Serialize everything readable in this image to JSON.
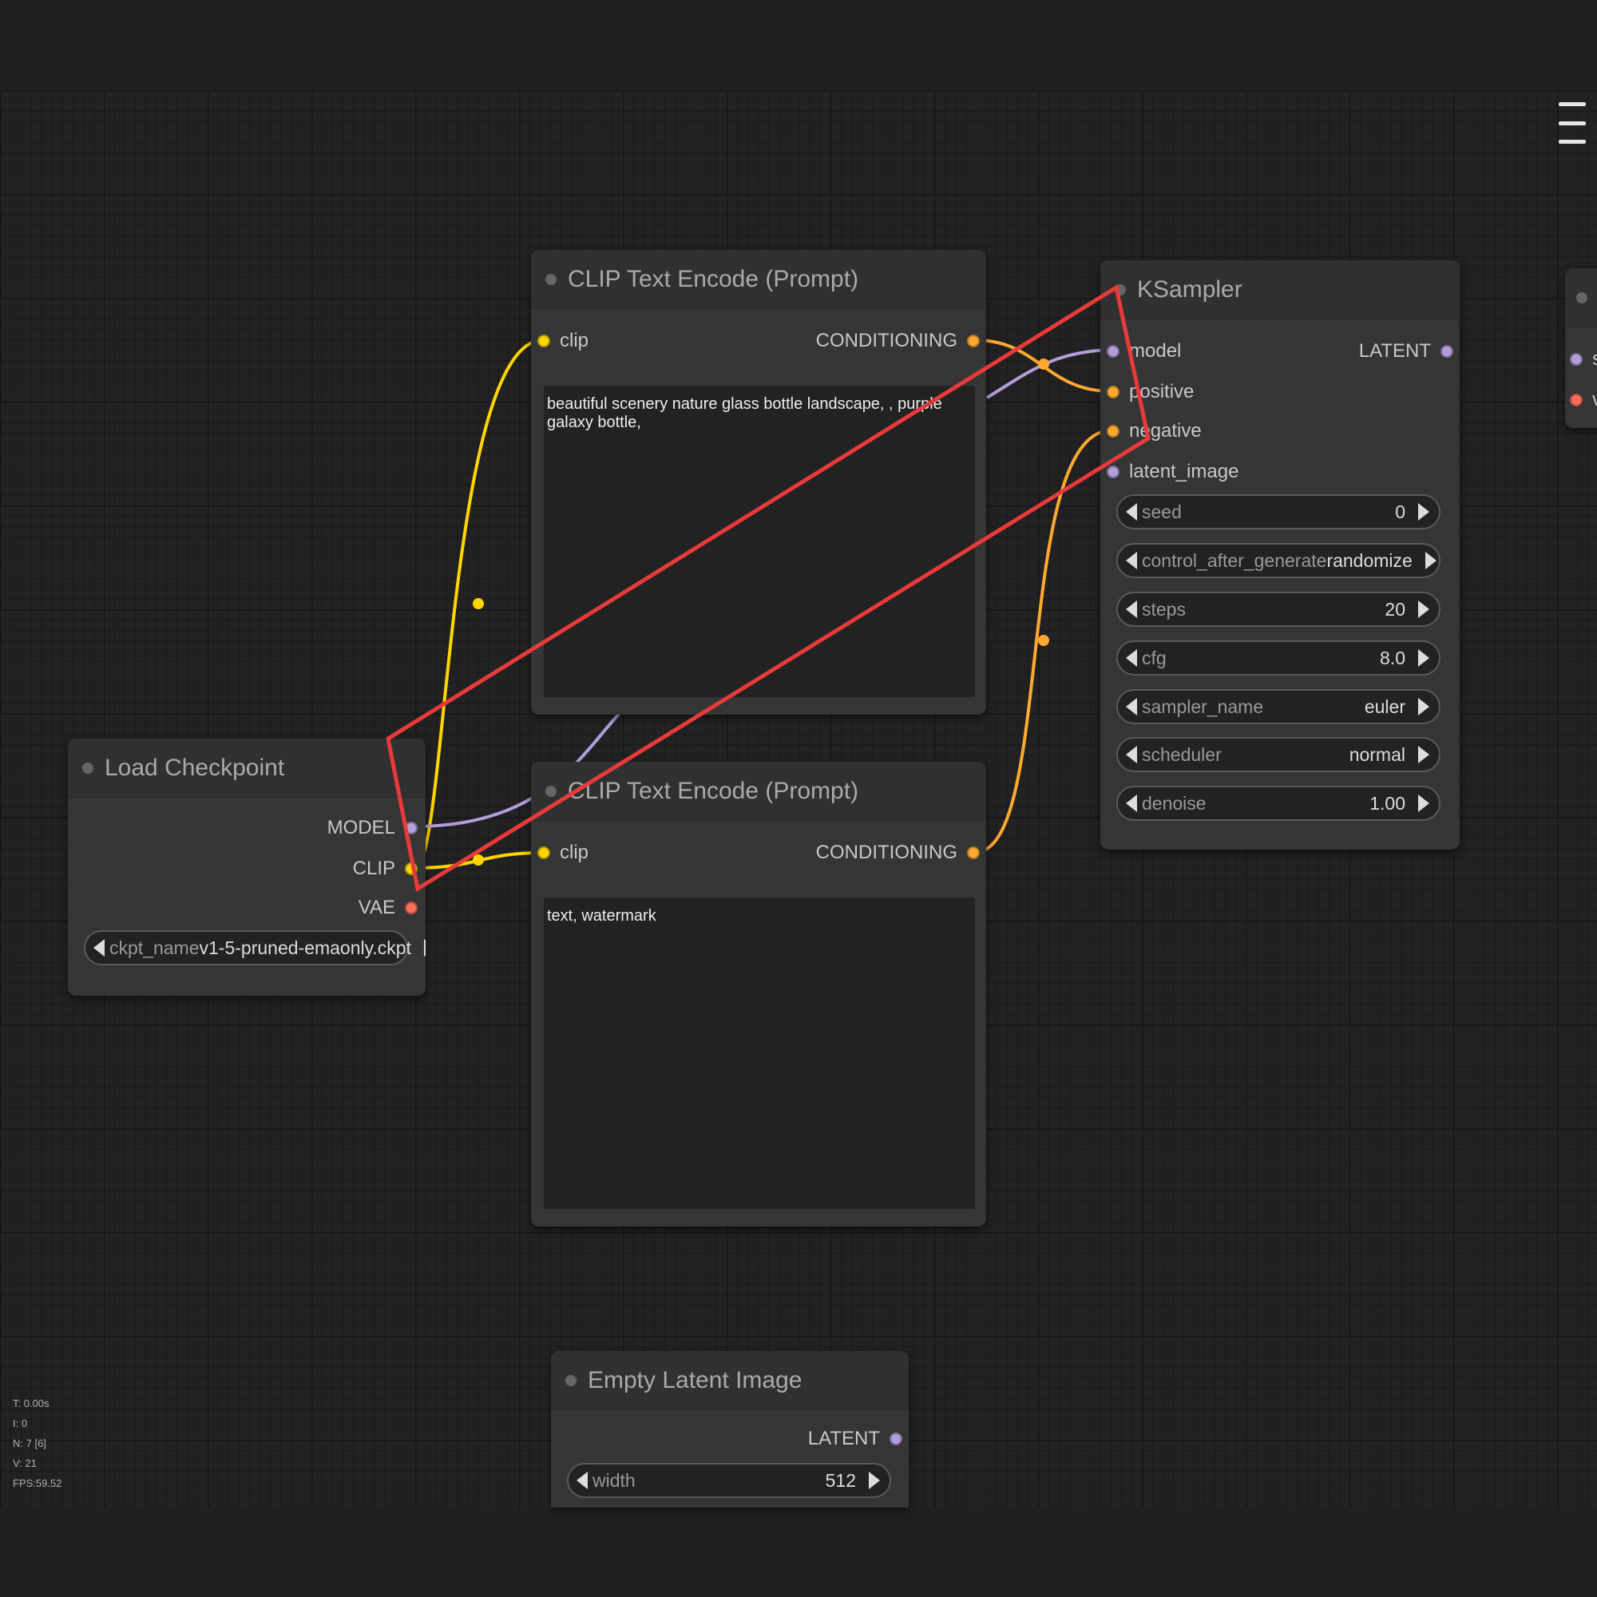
{
  "stats": {
    "time": "T: 0.00s",
    "i": "I: 0",
    "nodes": "N: 7 [6]",
    "v": "V: 21",
    "fps": "FPS:59.52"
  },
  "load_checkpoint": {
    "title": "Load Checkpoint",
    "outputs": [
      "MODEL",
      "CLIP",
      "VAE"
    ],
    "ckpt_label": "ckpt_name",
    "ckpt_value": "v1-5-pruned-emaonly.ckpt"
  },
  "clip_positive": {
    "title": "CLIP Text Encode (Prompt)",
    "input": "clip",
    "output": "CONDITIONING",
    "text": "beautiful scenery nature glass bottle landscape, , purple galaxy bottle,"
  },
  "clip_negative": {
    "title": "CLIP Text Encode (Prompt)",
    "input": "clip",
    "output": "CONDITIONING",
    "text": "text, watermark"
  },
  "ksampler": {
    "title": "KSampler",
    "inputs": [
      "model",
      "positive",
      "negative",
      "latent_image"
    ],
    "output": "LATENT",
    "widgets": [
      {
        "label": "seed",
        "value": "0"
      },
      {
        "label": "control_after_generate",
        "value": "randomize"
      },
      {
        "label": "steps",
        "value": "20"
      },
      {
        "label": "cfg",
        "value": "8.0"
      },
      {
        "label": "sampler_name",
        "value": "euler"
      },
      {
        "label": "scheduler",
        "value": "normal"
      },
      {
        "label": "denoise",
        "value": "1.00"
      }
    ]
  },
  "empty_latent": {
    "title": "Empty Latent Image",
    "output": "LATENT",
    "width_label": "width",
    "width_value": "512"
  },
  "vae_decode_partial": {
    "inputs": [
      "sa",
      "va"
    ]
  },
  "colors": {
    "clip": "#ffd500",
    "conditioning": "#ffa931",
    "model": "#b39ddb",
    "latent": "#ff9cf9",
    "vae": "#ff6e5c",
    "annotation": "#e83a3a"
  }
}
